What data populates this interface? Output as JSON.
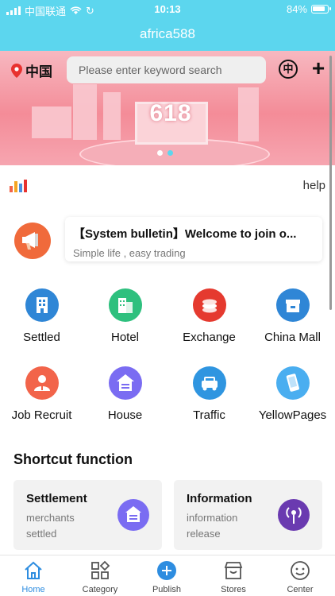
{
  "status_bar": {
    "carrier": "中国联通",
    "time": "10:13",
    "battery": "84%"
  },
  "nav": {
    "title": "africa588"
  },
  "header": {
    "location": "中国",
    "search_placeholder": "Please enter keyword search",
    "lang_icon_glyph": "中"
  },
  "banner": {
    "text": "618",
    "slide_count": 2,
    "active_slide": 2
  },
  "help": {
    "label": "help"
  },
  "bulletin": {
    "title": "【System bulletin】Welcome to join o...",
    "subtitle": "Simple life , easy trading"
  },
  "grid": {
    "items": [
      {
        "label": "Settled",
        "icon": "building-icon",
        "color": "#2f86d6"
      },
      {
        "label": "Hotel",
        "icon": "hotel-icon",
        "color": "#2ec07e"
      },
      {
        "label": "Exchange",
        "icon": "coins-icon",
        "color": "#e53a2f"
      },
      {
        "label": "China Mall",
        "icon": "shop-icon",
        "color": "#2f86d6"
      },
      {
        "label": "Job Recruit",
        "icon": "person-icon",
        "color": "#f2644a"
      },
      {
        "label": "House",
        "icon": "house-icon",
        "color": "#7a6cf2"
      },
      {
        "label": "Traffic",
        "icon": "car-icon",
        "color": "#2f95e0"
      },
      {
        "label": "YellowPages",
        "icon": "phone-icon",
        "color": "#4aaef0"
      }
    ]
  },
  "shortcut": {
    "title": "Shortcut function",
    "cards": [
      {
        "title": "Settlement",
        "desc": "merchants settled",
        "icon": "house-icon",
        "color": "#7a6cf2"
      },
      {
        "title": "Information",
        "desc": "information release",
        "icon": "broadcast-icon",
        "color": "#6a3ab0"
      }
    ]
  },
  "tabbar": {
    "tabs": [
      {
        "label": "Home",
        "icon": "home-icon",
        "active": true
      },
      {
        "label": "Category",
        "icon": "category-icon",
        "active": false
      },
      {
        "label": "Publish",
        "icon": "plus-circle-icon",
        "active": false
      },
      {
        "label": "Stores",
        "icon": "store-icon",
        "active": false
      },
      {
        "label": "Center",
        "icon": "smile-icon",
        "active": false
      }
    ]
  },
  "colors": {
    "primary": "#5cd6ee",
    "active_tab": "#2e8de0"
  }
}
